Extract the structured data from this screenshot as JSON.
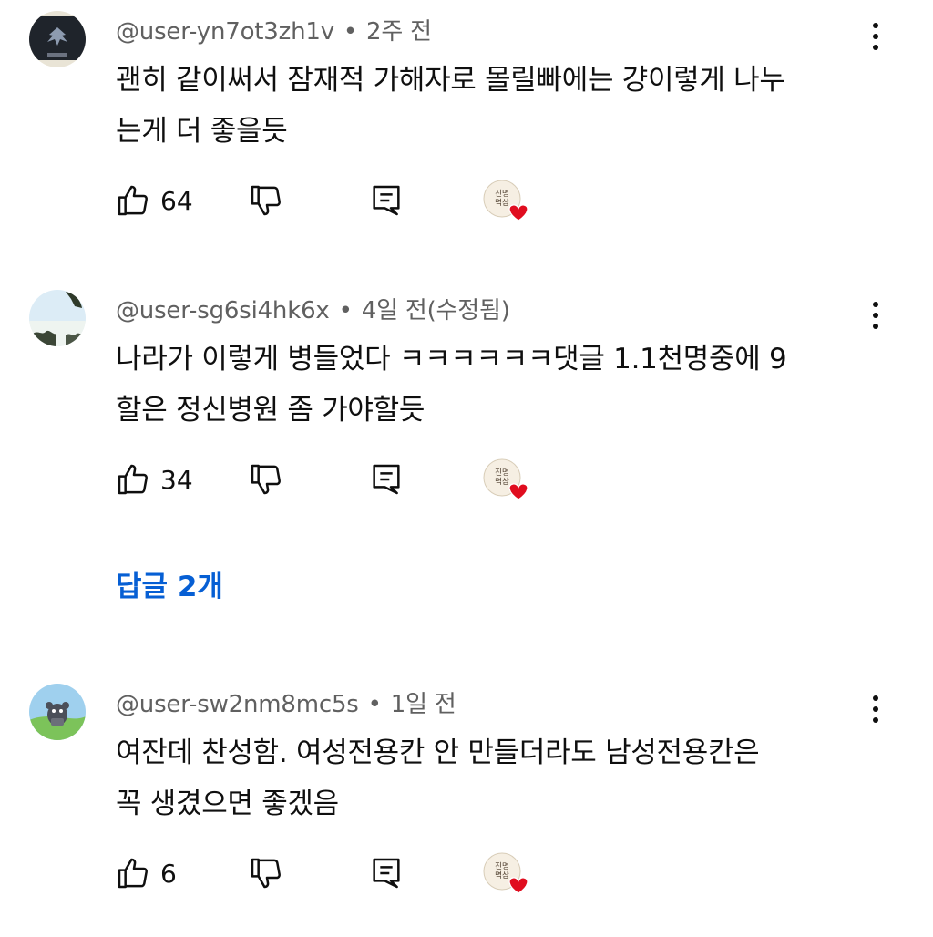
{
  "comments": [
    {
      "handle": "@user-yn7ot3zh1v",
      "time": "2주 전",
      "text_line1": "괜히 같이써서 잠재적 가해자로 몰릴빠에는 걍이렇게 나누",
      "text_line2": "는게 더 좋을듯",
      "likes": "64",
      "avatar_icon": "dark-emblem-avatar"
    },
    {
      "handle": "@user-sg6si4hk6x",
      "time": "4일 전(수정됨)",
      "text_line1": "나라가 이렇게 병들었다 ㅋㅋㅋㅋㅋㅋ댓글 1.1천명중에 9",
      "text_line2": "할은 정신병원 좀 가야할듯",
      "likes": "34",
      "avatar_icon": "sky-tree-avatar"
    },
    {
      "handle": "@user-sw2nm8mc5s",
      "time": "1일 전",
      "text_line1": "여잔데 찬성함. 여성전용칸 안 만들더라도 남성전용칸은",
      "text_line2": "꼭 생겼으면 좋겠음",
      "likes": "6",
      "avatar_icon": "cartoon-character-avatar"
    }
  ],
  "replies_label": "답글 2개",
  "badge_text": "진명 멱삼",
  "colors": {
    "link": "#065fd4",
    "meta": "#606060",
    "heart": "#e00d1f"
  }
}
